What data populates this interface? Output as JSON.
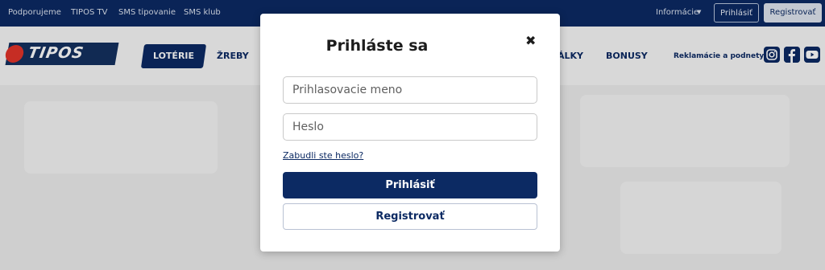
{
  "topbar": {
    "links": [
      "Podporujeme",
      "TIPOS TV",
      "SMS tipovanie",
      "SMS klub"
    ],
    "info_label": "Informácie",
    "login_label": "Prihlásiť",
    "register_label": "Registrovať"
  },
  "nav": {
    "logo_text": "TIPOS",
    "items": [
      "LOTÉRIE",
      "ŽREBY",
      "ÁLKY",
      "BONUSY"
    ],
    "reklamacie": "Reklamácie a podnety"
  },
  "modal": {
    "title": "Prihláste sa",
    "username_placeholder": "Prihlasovacie meno",
    "password_placeholder": "Heslo",
    "forgot_link": "Zabudli ste heslo?",
    "login_button": "Prihlásiť",
    "register_button": "Registrovať"
  },
  "colors": {
    "brand_navy": "#0c2a63",
    "logo_red": "#e2342a"
  },
  "icons": [
    "close-icon",
    "instagram-icon",
    "facebook-icon",
    "youtube-icon",
    "chevron-down-icon"
  ]
}
